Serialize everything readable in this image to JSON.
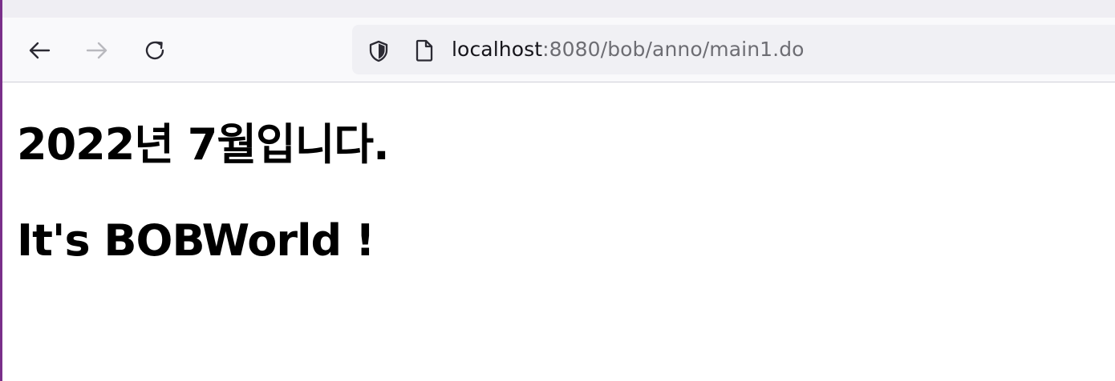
{
  "browser": {
    "icons": {
      "back": "arrow-left-icon",
      "forward": "arrow-right-icon",
      "reload": "reload-icon",
      "security": "shield-icon",
      "page": "page-icon"
    },
    "address_bar": {
      "host": "localhost",
      "rest": ":8080/bob/anno/main1.do"
    },
    "colors": {
      "toolbar_bg": "#f9f9fb",
      "tabstrip_bg": "#efeef3",
      "urlbar_bg": "#f0f0f4",
      "window_edge": "#7a2f8a",
      "url_muted": "#6d6d73"
    }
  },
  "page": {
    "heading_1": "2022년 7월입니다.",
    "heading_2": "It's BOBWorld !"
  }
}
